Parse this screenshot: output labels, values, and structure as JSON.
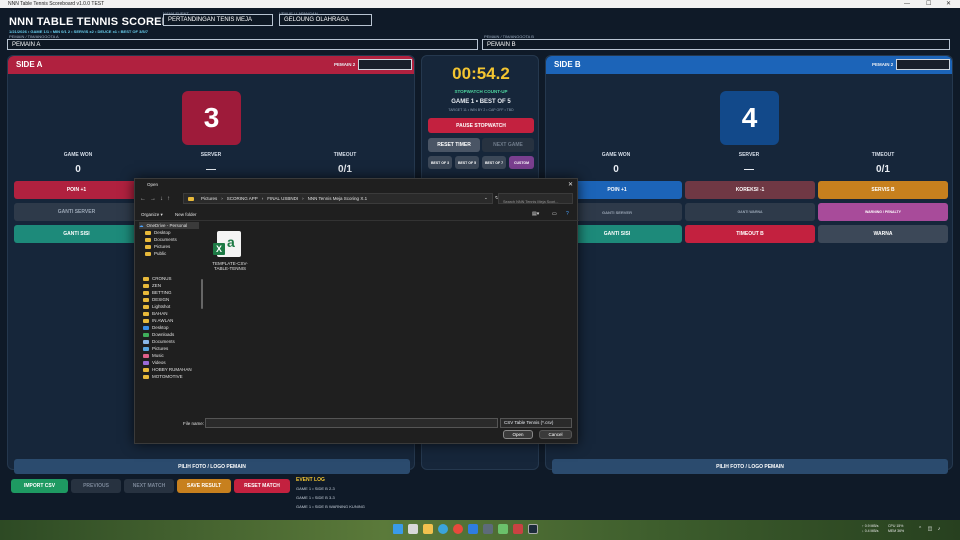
{
  "window": {
    "title": "NNN Table Tennis Scoreboard v1.0.0 TEST"
  },
  "header": {
    "title": "NNN TABLE TENNIS SCOREBOARD",
    "status_line": "1/21/2026 • GAME 1/1 • MIN 0/1 2 • SERVIS x2 • DEUCE x1 • BEST OF 3/5/7",
    "player_a_caption": "PEMAIN / TIM/ANGGOTA A",
    "player_b_caption": "PEMAIN / TIM/ANGGOTA B",
    "event_caption": "NAMA EVENT",
    "venue_caption": "VENUE / LAPANGAN",
    "event_value": "PERTANDINGAN TENIS MEJA",
    "venue_value": "GELOUNG OLAHRAGA",
    "player_a": "PEMAIN A",
    "player_b": "PEMAIN B"
  },
  "side_a": {
    "title": "SIDE A",
    "pemain_label": "PEMAIN 2",
    "score": "3",
    "game_won_label": "GAME WON",
    "game_won": "0",
    "server_label": "SERVER",
    "server": "—",
    "timeout_label": "TIMEOUT",
    "timeout": "0/1",
    "btn_poin": "POIN +1",
    "btn_ganti_server": "GANTI SERVER",
    "btn_ganti_sisi": "GANTI SISI",
    "btn_foto": "PILIH FOTO / LOGO PEMAIN"
  },
  "side_b": {
    "title": "SIDE B",
    "pemain_label": "PEMAIN 2",
    "score": "4",
    "game_won_label": "GAME WON",
    "game_won": "0",
    "server_label": "SERVER",
    "server": "—",
    "timeout_label": "TIMEOUT",
    "timeout": "0/1",
    "btn_poin": "POIN +1",
    "btn_koreksi": "KOREKSI -1",
    "btn_servis": "SERVIS B",
    "btn_ganti_server": "GANTI SERVER",
    "btn_ganti_warna": "GANTI WARNA",
    "btn_warning": "WARNING / PENALTY",
    "btn_ganti_sisi": "GANTI SISI",
    "btn_timeout": "TIMEOUT B",
    "btn_warna": "WARNA",
    "btn_foto": "PILIH FOTO / LOGO PEMAIN"
  },
  "center": {
    "timer": "00:54.2",
    "mode": "STOPWATCH COUNT-UP",
    "game_info": "GAME 1 • BEST OF 5",
    "target": "TARGET 11 • WIN BY 2 • CAP OFF • TBD",
    "btn_pause": "PAUSE STOPWATCH",
    "btn_reset_timer": "RESET TIMER",
    "btn_next_game": "NEXT GAME",
    "best_of": [
      "BEST OF 3",
      "BEST OF 5",
      "BEST OF 7",
      "CUSTOM"
    ]
  },
  "bottom": {
    "btn_import": "IMPORT CSV",
    "btn_previous": "PREVIOUS",
    "btn_next_match": "NEXT MATCH",
    "btn_save": "SAVE RESULT",
    "btn_reset": "RESET MATCH",
    "log_title": "EVENT LOG",
    "log": [
      "GAME 1 • SIDE B 2-3",
      "GAME 1 • SIDE B 3-3",
      "GAME 1 • SIDE B WARNING KUNING"
    ]
  },
  "dialog": {
    "title": "Open",
    "breadcrumb": [
      "Pictures",
      "SCORING APP",
      "FINAL USBNDI",
      "NNN Tennis Meja Scoring X.1"
    ],
    "search_placeholder": "Search NNN Tennis Meja Scori...",
    "organize": "Organize ▾",
    "new_folder": "New folder",
    "nav_top": [
      {
        "label": "OneDrive - Personal",
        "icon": "cloud"
      },
      {
        "label": "Desktop",
        "icon": "folder"
      },
      {
        "label": "Documents",
        "icon": "folder"
      },
      {
        "label": "Pictures",
        "icon": "folder"
      },
      {
        "label": "Public",
        "icon": "folder"
      }
    ],
    "nav_bottom": [
      {
        "label": "CRONUS",
        "icon": "folder"
      },
      {
        "label": "ZEN",
        "icon": "folder"
      },
      {
        "label": "BETTING",
        "icon": "folder"
      },
      {
        "label": "DESIGN",
        "icon": "folder"
      },
      {
        "label": "Lightshot",
        "icon": "folder"
      },
      {
        "label": "BAHAN",
        "icon": "folder"
      },
      {
        "label": "IN AWLAN",
        "icon": "folder"
      },
      {
        "label": "Desktop",
        "icon": "desktop"
      },
      {
        "label": "Downloads",
        "icon": "download"
      },
      {
        "label": "Documents",
        "icon": "doc"
      },
      {
        "label": "Pictures",
        "icon": "picture"
      },
      {
        "label": "Music",
        "icon": "music"
      },
      {
        "label": "Videos",
        "icon": "video"
      },
      {
        "label": "HOBBY RUMAHAN",
        "icon": "folder"
      },
      {
        "label": "MOTOMOTIVE",
        "icon": "folder"
      }
    ],
    "file": {
      "name": "TEMPLATE-CSV-TABLE-TENNIS",
      "icon": "excel-icon"
    },
    "file_name_label": "File name:",
    "file_name_value": "",
    "file_type": "CSV Table Tennis (*.csv)",
    "btn_open": "Open",
    "btn_cancel": "Cancel"
  },
  "tray": {
    "net1": "↑ 0.9 MB/s",
    "net2": "↓ 0.4 MB/s",
    "cpu": "CPU 15%",
    "mem": "MEM 36%",
    "time": "",
    "date": ""
  }
}
